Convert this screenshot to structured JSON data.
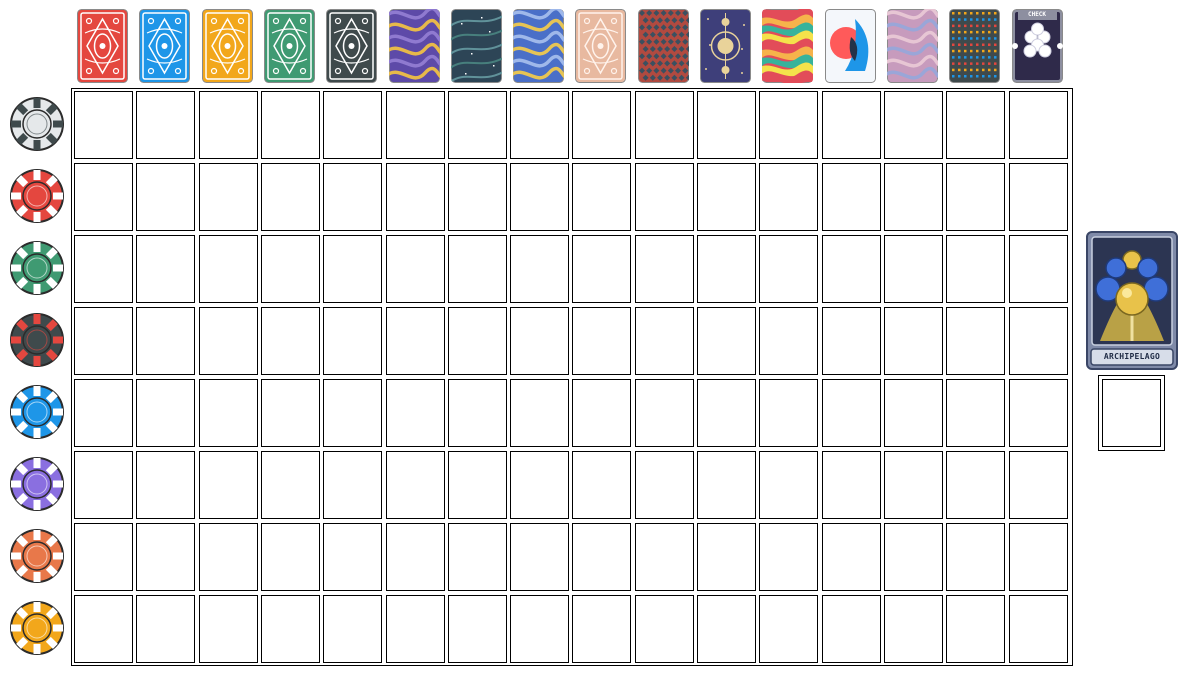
{
  "decks": [
    {
      "name": "red-deck",
      "style": "ornate",
      "colors": [
        "#e4473f",
        "#ffffff"
      ]
    },
    {
      "name": "blue-deck",
      "style": "ornate",
      "colors": [
        "#1e96e8",
        "#ffffff"
      ]
    },
    {
      "name": "yellow-deck",
      "style": "ornate",
      "colors": [
        "#f2a71b",
        "#ffffff"
      ]
    },
    {
      "name": "green-deck",
      "style": "ornate",
      "colors": [
        "#3f9a72",
        "#ffffff"
      ]
    },
    {
      "name": "black-deck",
      "style": "ornate",
      "colors": [
        "#3f4a4c",
        "#ffffff"
      ]
    },
    {
      "name": "magic-deck",
      "style": "marble",
      "colors": [
        "#5d4aa8",
        "#e7b94a",
        "#8f7ad0"
      ]
    },
    {
      "name": "nebula-deck",
      "style": "nebula",
      "colors": [
        "#2d4556",
        "#4c8a84",
        "#6aa0a6"
      ]
    },
    {
      "name": "ghost-deck",
      "style": "marble",
      "colors": [
        "#4a6fc8",
        "#e6c455",
        "#9fb8ea"
      ]
    },
    {
      "name": "abandoned-deck",
      "style": "ornate",
      "colors": [
        "#e8b9a0",
        "#fff3ec"
      ]
    },
    {
      "name": "checkered-deck",
      "style": "diamonds",
      "colors": [
        "#b14a40",
        "#3b5060"
      ]
    },
    {
      "name": "zodiac-deck",
      "style": "zodiac",
      "colors": [
        "#3e3f7a",
        "#e9d39a"
      ]
    },
    {
      "name": "painted-deck",
      "style": "stripes",
      "colors": [
        "#e24c59",
        "#f6b34b",
        "#37b39b",
        "#f4e24b"
      ]
    },
    {
      "name": "anaglyph-deck",
      "style": "anaglyph",
      "colors": [
        "#ff5a5a",
        "#1e96e8",
        "#243247"
      ]
    },
    {
      "name": "plasma-deck",
      "style": "marble",
      "colors": [
        "#c79bbd",
        "#9aa6d8",
        "#e7c6d4"
      ]
    },
    {
      "name": "erratic-deck",
      "style": "dots",
      "colors": [
        "#3f4a4c",
        "#f2a71b",
        "#e4473f",
        "#1e96e8"
      ]
    },
    {
      "name": "challenge-deck",
      "style": "challenge",
      "colors": [
        "#2f2a4a",
        "#8d8fa0"
      ],
      "label": "CHECK"
    }
  ],
  "chips": [
    {
      "name": "white-stake-chip",
      "color": "#e5e8ea",
      "accent": "#3f4a4c"
    },
    {
      "name": "red-stake-chip",
      "color": "#e4473f",
      "accent": "#ffffff"
    },
    {
      "name": "green-stake-chip",
      "color": "#3f9a72",
      "accent": "#ffffff"
    },
    {
      "name": "black-stake-chip",
      "color": "#3f4a4c",
      "accent": "#e4473f"
    },
    {
      "name": "blue-stake-chip",
      "color": "#1e96e8",
      "accent": "#ffffff"
    },
    {
      "name": "purple-stake-chip",
      "color": "#8a6fe0",
      "accent": "#ffffff"
    },
    {
      "name": "orange-stake-chip",
      "color": "#e8784a",
      "accent": "#ffffff"
    },
    {
      "name": "gold-stake-chip",
      "color": "#f2a71b",
      "accent": "#ffffff"
    }
  ],
  "grid": {
    "rows": 8,
    "cols": 16
  },
  "joker": {
    "label": "ARCHIPELAGO",
    "colors": [
      "#5b6b8e",
      "#e8c24a",
      "#3f6fd8"
    ]
  }
}
